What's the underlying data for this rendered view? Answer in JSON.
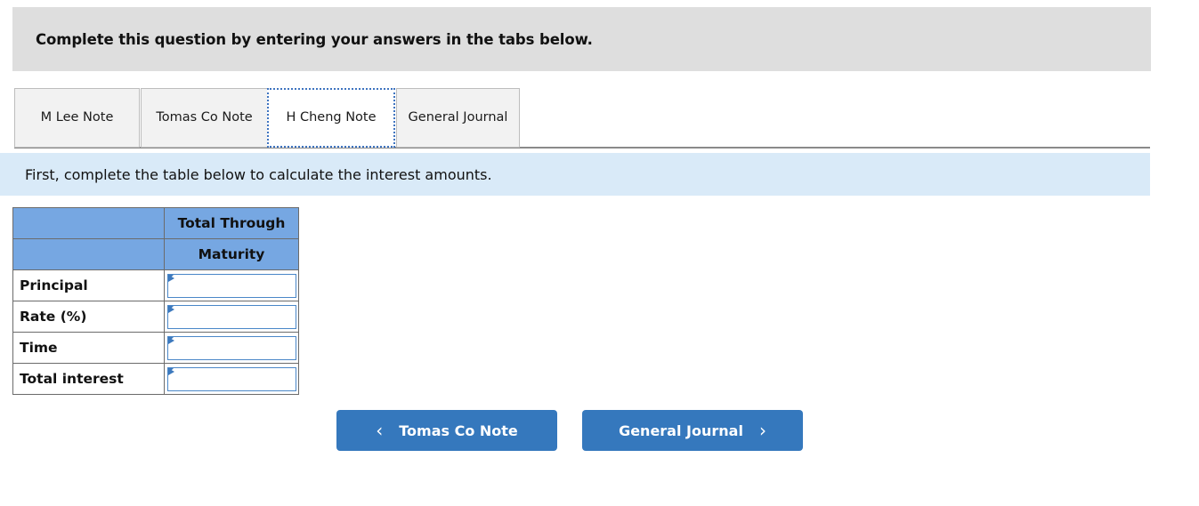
{
  "header": {
    "instruction": "Complete this question by entering your answers in the tabs below."
  },
  "tabs": [
    {
      "label": "M Lee Note",
      "active": false
    },
    {
      "label": "Tomas Co Note",
      "active": false
    },
    {
      "label": "H Cheng Note",
      "active": true
    },
    {
      "label": "General Journal",
      "active": false
    }
  ],
  "info_banner": {
    "text": "First, complete the table below to calculate the interest amounts."
  },
  "table": {
    "column_header_line1": "Total Through",
    "column_header_line2": "Maturity",
    "rows": [
      {
        "label": "Principal",
        "value": ""
      },
      {
        "label": "Rate (%)",
        "value": ""
      },
      {
        "label": "Time",
        "value": ""
      },
      {
        "label": "Total interest",
        "value": ""
      }
    ]
  },
  "navigation": {
    "prev_label": "Tomas Co Note",
    "prev_icon": "chevron-left-icon",
    "prev_chevron": "‹",
    "next_label": "General Journal",
    "next_icon": "chevron-right-icon",
    "next_chevron": "›"
  },
  "colors": {
    "header_grey": "#dedede",
    "info_blue": "#d9eaf8",
    "table_header_blue": "#76a7e2",
    "button_blue": "#3578bd",
    "focus_blue": "#3f74c0"
  }
}
